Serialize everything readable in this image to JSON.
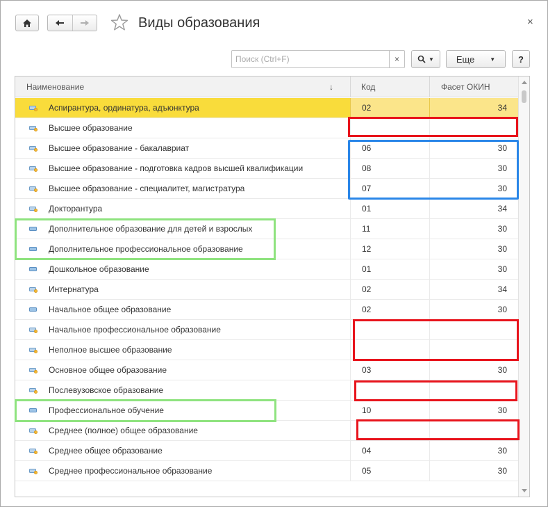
{
  "window": {
    "title": "Виды образования",
    "close_glyph": "×"
  },
  "toolbar": {
    "search_placeholder": "Поиск (Ctrl+F)",
    "search_clear": "×",
    "more_label": "Еще",
    "help_label": "?"
  },
  "table": {
    "columns": {
      "name": "Наименование",
      "sort_indicator": "↓",
      "code": "Код",
      "facet": "Фасет ОКИН"
    },
    "rows": [
      {
        "name": "Аспирантура, ординатура, адъюнктура",
        "code": "02",
        "facet": "34",
        "selected": true,
        "icon": "item-icon-yellow"
      },
      {
        "name": "Высшее образование",
        "code": "",
        "facet": "",
        "icon": "item-icon-yellow"
      },
      {
        "name": "Высшее образование - бакалавриат",
        "code": "06",
        "facet": "30",
        "icon": "item-icon-yellow"
      },
      {
        "name": "Высшее образование - подготовка кадров высшей квалификации",
        "code": "08",
        "facet": "30",
        "icon": "item-icon-yellow"
      },
      {
        "name": "Высшее образование - специалитет, магистратура",
        "code": "07",
        "facet": "30",
        "icon": "item-icon-yellow"
      },
      {
        "name": "Докторантура",
        "code": "01",
        "facet": "34",
        "icon": "item-icon-yellow"
      },
      {
        "name": "Дополнительное образование для детей и взрослых",
        "code": "11",
        "facet": "30",
        "icon": "item-icon-blue"
      },
      {
        "name": "Дополнительное профессиональное образование",
        "code": "12",
        "facet": "30",
        "icon": "item-icon-blue"
      },
      {
        "name": "Дошкольное образование",
        "code": "01",
        "facet": "30",
        "icon": "item-icon-blue"
      },
      {
        "name": "Интернатура",
        "code": "02",
        "facet": "34",
        "icon": "item-icon-yellow"
      },
      {
        "name": "Начальное общее образование",
        "code": "02",
        "facet": "30",
        "icon": "item-icon-blue"
      },
      {
        "name": "Начальное профессиональное образование",
        "code": "",
        "facet": "",
        "icon": "item-icon-yellow"
      },
      {
        "name": "Неполное высшее образование",
        "code": "",
        "facet": "",
        "icon": "item-icon-yellow"
      },
      {
        "name": "Основное общее образование",
        "code": "03",
        "facet": "30",
        "icon": "item-icon-yellow"
      },
      {
        "name": "Послевузовское образование",
        "code": "",
        "facet": "",
        "icon": "item-icon-yellow"
      },
      {
        "name": "Профессиональное обучение",
        "code": "10",
        "facet": "30",
        "icon": "item-icon-blue"
      },
      {
        "name": "Среднее (полное) общее образование",
        "code": "",
        "facet": "",
        "icon": "item-icon-yellow"
      },
      {
        "name": "Среднее общее образование",
        "code": "04",
        "facet": "30",
        "icon": "item-icon-yellow"
      },
      {
        "name": "Среднее профессиональное образование",
        "code": "05",
        "facet": "30",
        "icon": "item-icon-yellow"
      }
    ]
  },
  "colors": {
    "selection": "#f9dc3b",
    "annotation_red": "#e8141c",
    "annotation_blue": "#2a86e8",
    "annotation_green": "#8fe37f"
  }
}
